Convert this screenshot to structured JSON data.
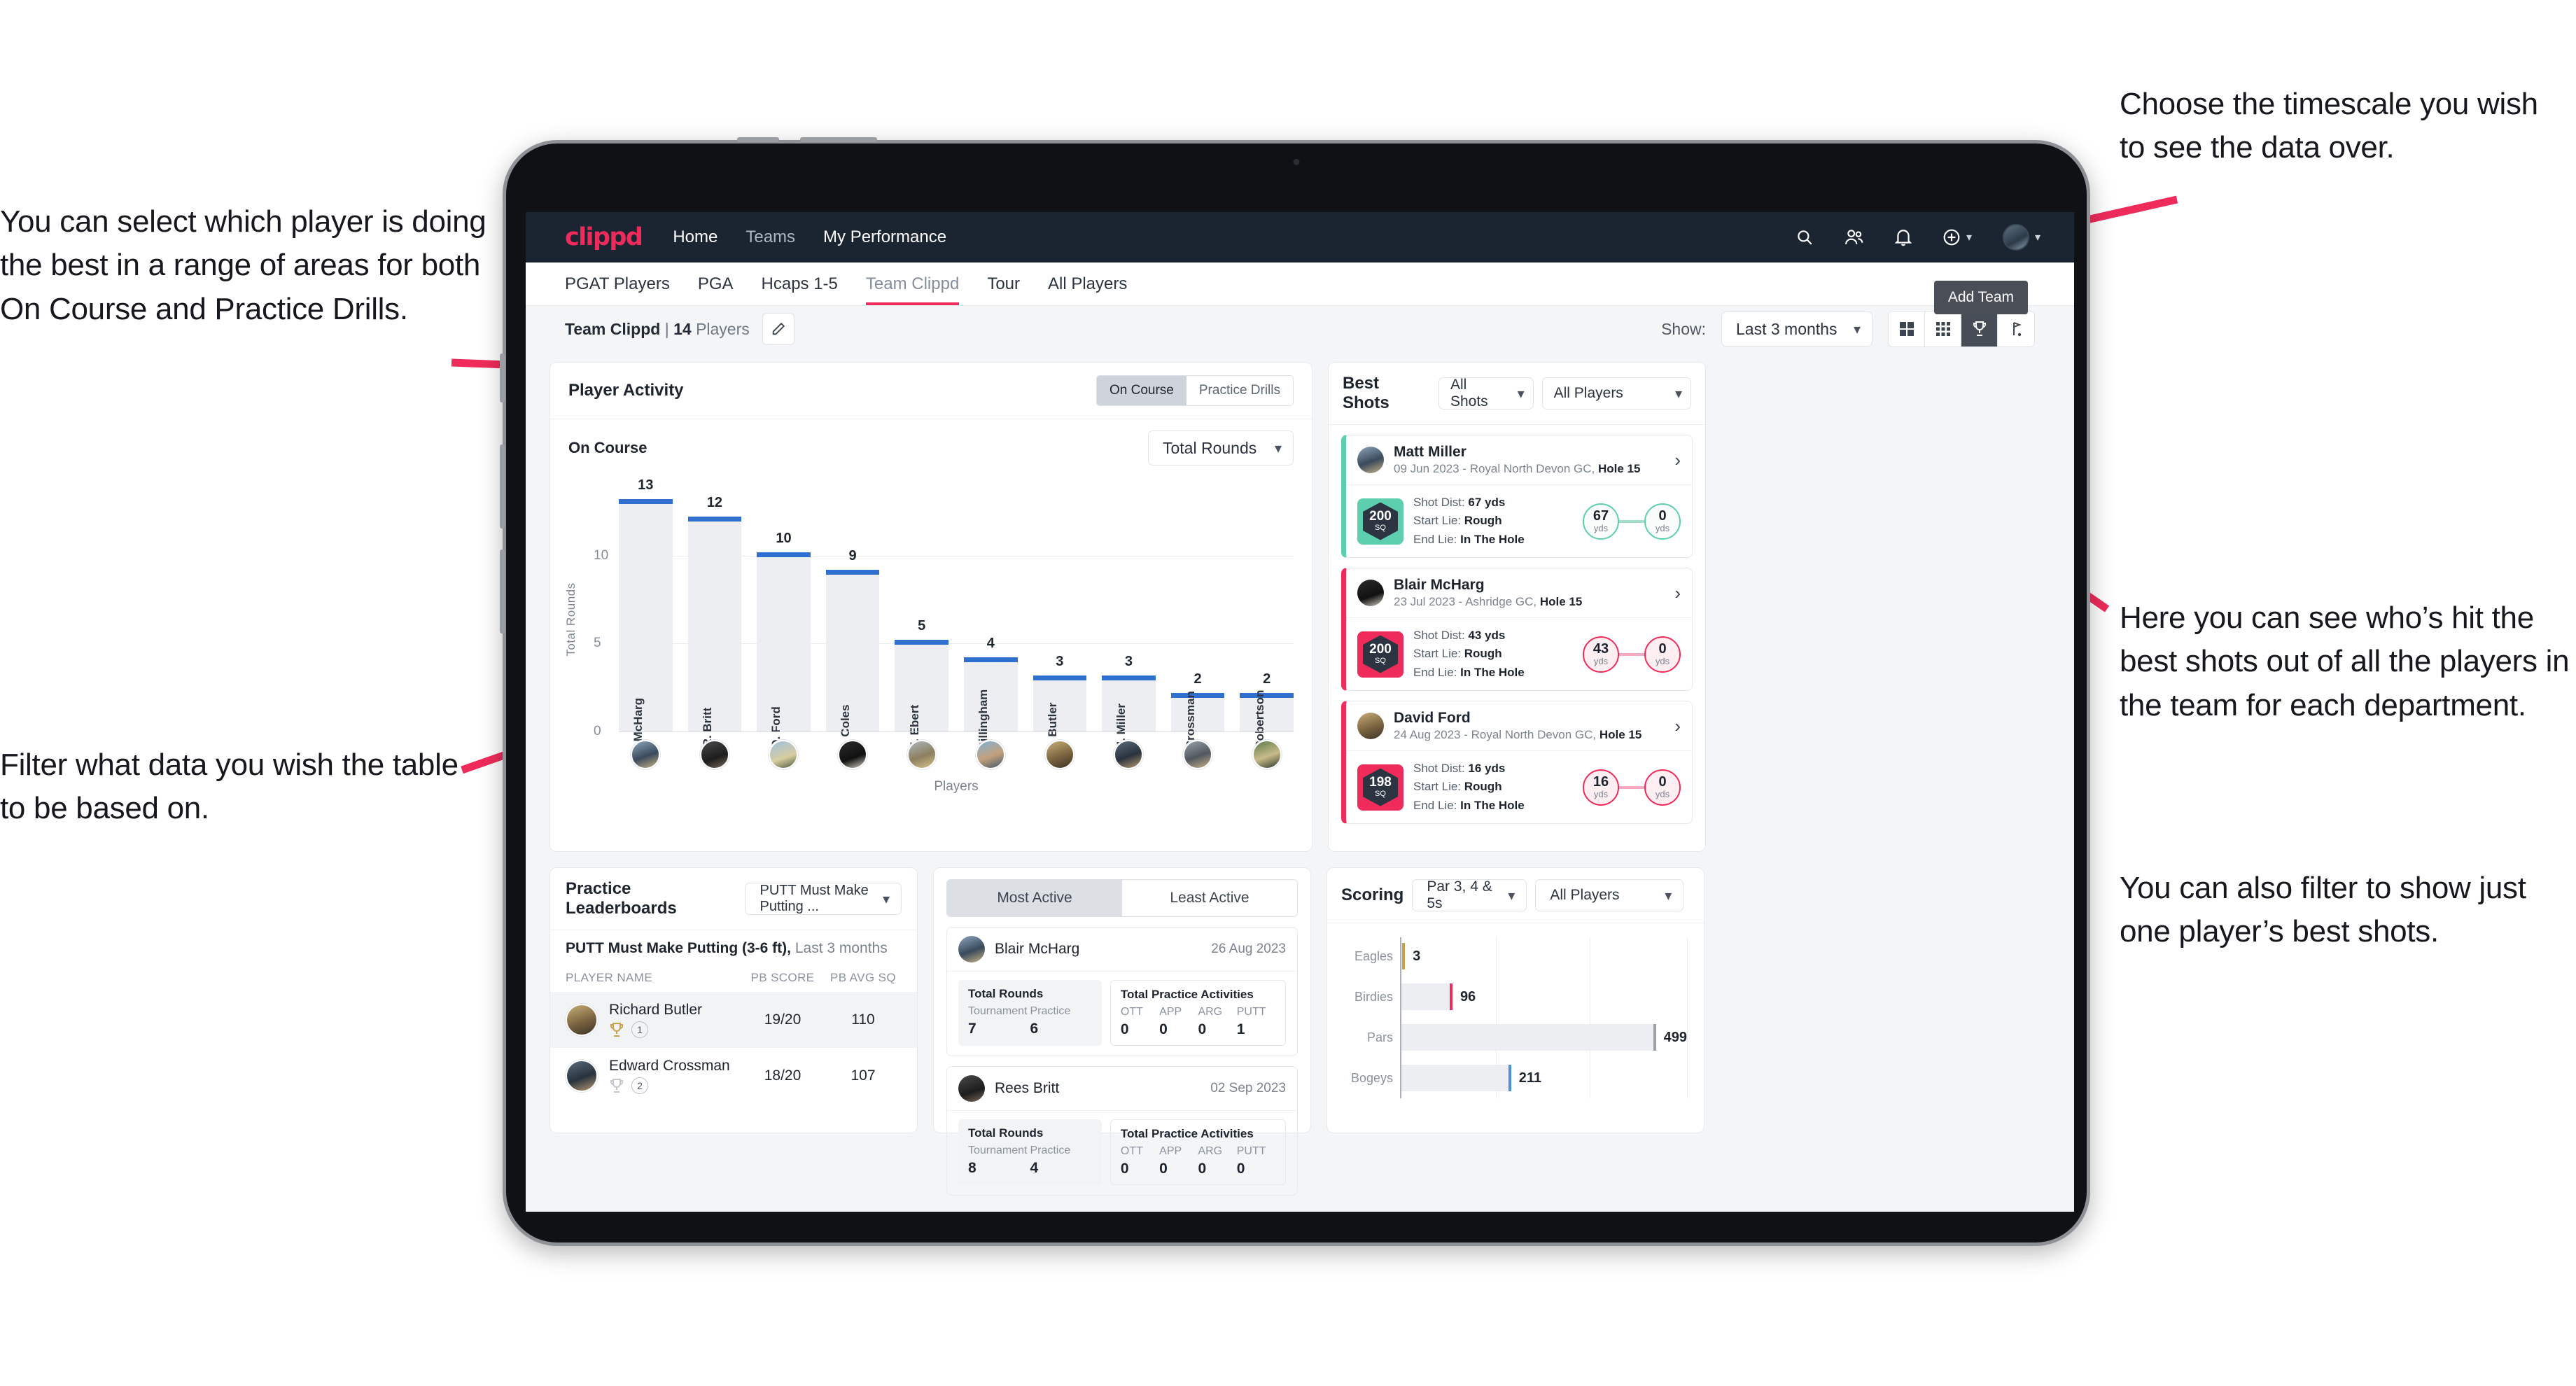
{
  "annotations": {
    "left_top": "You can select which player is doing the best in a range of areas for both On Course and Practice Drills.",
    "left_bottom": "Filter what data you wish the table to be based on.",
    "right_top": "Choose the timescale you wish to see the data over.",
    "right_middle": "Here you can see who’s hit the best shots out of all the players in the team for each department.",
    "right_bottom": "You can also filter to show just one player’s best shots."
  },
  "app": {
    "logo": "clippd",
    "nav_links": [
      {
        "label": "Home",
        "active": true
      },
      {
        "label": "Teams",
        "active": false
      },
      {
        "label": "My Performance",
        "active": true
      }
    ],
    "nav_icons": [
      "search-icon",
      "people-icon",
      "bell-icon",
      "plus-circle-icon",
      "avatar"
    ],
    "tabs": [
      {
        "label": "PGAT Players",
        "active": false
      },
      {
        "label": "PGA",
        "active": false
      },
      {
        "label": "Hcaps 1-5",
        "active": false
      },
      {
        "label": "Team Clippd",
        "active": true
      },
      {
        "label": "Tour",
        "active": false
      },
      {
        "label": "All Players",
        "active": false
      }
    ],
    "tooltip_add_team": "Add Team",
    "toolbar": {
      "team_name": "Team Clippd",
      "separator": "|",
      "player_count": "14",
      "players_word": "Players",
      "edit_icon": "pencil-icon",
      "show_label": "Show:",
      "timescale_value": "Last 3 months",
      "view_icons": [
        "grid-large-icon",
        "grid-small-icon",
        "trophy-icon",
        "flag-icon"
      ],
      "active_view": "trophy-icon"
    }
  },
  "player_activity": {
    "title": "Player Activity",
    "toggle": [
      {
        "label": "On Course",
        "active": true
      },
      {
        "label": "Practice Drills",
        "active": false
      }
    ],
    "sub_label": "On Course",
    "metric_select": "Total Rounds"
  },
  "best_shots": {
    "title": "Best Shots",
    "shot_filter": "All Shots",
    "player_filter": "All Players",
    "cards": [
      {
        "accent": "teal",
        "name": "Matt Miller",
        "meta_date": "09 Jun 2023",
        "meta_sep": " - ",
        "meta_course": "Royal North Devon GC, ",
        "meta_hole": "Hole 15",
        "sq_value": "200",
        "sq_unit": "SQ",
        "shot_dist_label": "Shot Dist: ",
        "shot_dist_value": "67 yds",
        "start_lie_label": "Start Lie: ",
        "start_lie_value": "Rough",
        "end_lie_label": "End Lie: ",
        "end_lie_value": "In The Hole",
        "from_value": "67",
        "from_unit": "yds",
        "to_value": "0",
        "to_unit": "yds"
      },
      {
        "accent": "pink",
        "name": "Blair McHarg",
        "meta_date": "23 Jul 2023",
        "meta_sep": " - ",
        "meta_course": "Ashridge GC, ",
        "meta_hole": "Hole 15",
        "sq_value": "200",
        "sq_unit": "SQ",
        "shot_dist_label": "Shot Dist: ",
        "shot_dist_value": "43 yds",
        "start_lie_label": "Start Lie: ",
        "start_lie_value": "Rough",
        "end_lie_label": "End Lie: ",
        "end_lie_value": "In The Hole",
        "from_value": "43",
        "from_unit": "yds",
        "to_value": "0",
        "to_unit": "yds"
      },
      {
        "accent": "pink",
        "name": "David Ford",
        "meta_date": "24 Aug 2023",
        "meta_sep": " - ",
        "meta_course": "Royal North Devon GC, ",
        "meta_hole": "Hole 15",
        "sq_value": "198",
        "sq_unit": "SQ",
        "shot_dist_label": "Shot Dist: ",
        "shot_dist_value": "16 yds",
        "start_lie_label": "Start Lie: ",
        "start_lie_value": "Rough",
        "end_lie_label": "End Lie: ",
        "end_lie_value": "In The Hole",
        "from_value": "16",
        "from_unit": "yds",
        "to_value": "0",
        "to_unit": "yds"
      }
    ]
  },
  "practice_leaderboards": {
    "title": "Practice Leaderboards",
    "drill_select": "PUTT Must Make Putting ...",
    "sub_bold": "PUTT Must Make Putting (3-6 ft),",
    "sub_light": " Last 3 months",
    "columns": [
      "PLAYER NAME",
      "PB SCORE",
      "PB AVG SQ"
    ],
    "rows": [
      {
        "name": "Richard Butler",
        "rank": "1",
        "trophy": "gold",
        "pb_score": "19/20",
        "pb_avg_sq": "110",
        "highlight": true
      },
      {
        "name": "Edward Crossman",
        "rank": "2",
        "trophy": "silver",
        "pb_score": "18/20",
        "pb_avg_sq": "107",
        "highlight": false
      }
    ]
  },
  "activity_panel": {
    "tabs": [
      {
        "label": "Most Active",
        "active": true
      },
      {
        "label": "Least Active",
        "active": false
      }
    ],
    "rounds_title": "Total Rounds",
    "rounds_cols": [
      "Tournament",
      "Practice"
    ],
    "practice_title": "Total Practice Activities",
    "practice_cols": [
      "OTT",
      "APP",
      "ARG",
      "PUTT"
    ],
    "cards": [
      {
        "name": "Blair McHarg",
        "date": "26 Aug 2023",
        "tournament": "7",
        "practice": "6",
        "ott": "0",
        "app": "0",
        "arg": "0",
        "putt": "1"
      },
      {
        "name": "Rees Britt",
        "date": "02 Sep 2023",
        "tournament": "8",
        "practice": "4",
        "ott": "0",
        "app": "0",
        "arg": "0",
        "putt": "0"
      }
    ]
  },
  "colors": {
    "brand_pink": "#ef2b5b",
    "nav_dark": "#1b2532",
    "bar_blue": "#2f6fd0",
    "teal": "#5ecfae",
    "bar_gray": "#eceef1"
  },
  "chart_data": [
    {
      "type": "bar",
      "title": "Player Activity",
      "xlabel": "Players",
      "ylabel": "Total Rounds",
      "ylim": [
        0,
        14
      ],
      "yticks": [
        0,
        5,
        10
      ],
      "grid": true,
      "categories": [
        "B. McHarg",
        "R. Britt",
        "D. Ford",
        "J. Coles",
        "E. Ebert",
        "D. Billingham",
        "R. Butler",
        "M. Miller",
        "E. Crossman",
        "C. Robertson"
      ],
      "values": [
        13,
        12,
        10,
        9,
        5,
        4,
        3,
        3,
        2,
        2
      ],
      "legend": []
    },
    {
      "type": "bar",
      "orientation": "horizontal",
      "title": "Scoring",
      "filter_par": "Par 3, 4 & 5s",
      "filter_players": "All Players",
      "categories": [
        "Eagles",
        "Birdies",
        "Pars",
        "Bogeys"
      ],
      "values": [
        3,
        96,
        499,
        211
      ],
      "tip_colors": [
        "#c8a24a",
        "#ef2b5b",
        "#9aa0a8",
        "#4a90d9"
      ],
      "xlim": [
        0,
        560
      ],
      "grid": true
    }
  ]
}
